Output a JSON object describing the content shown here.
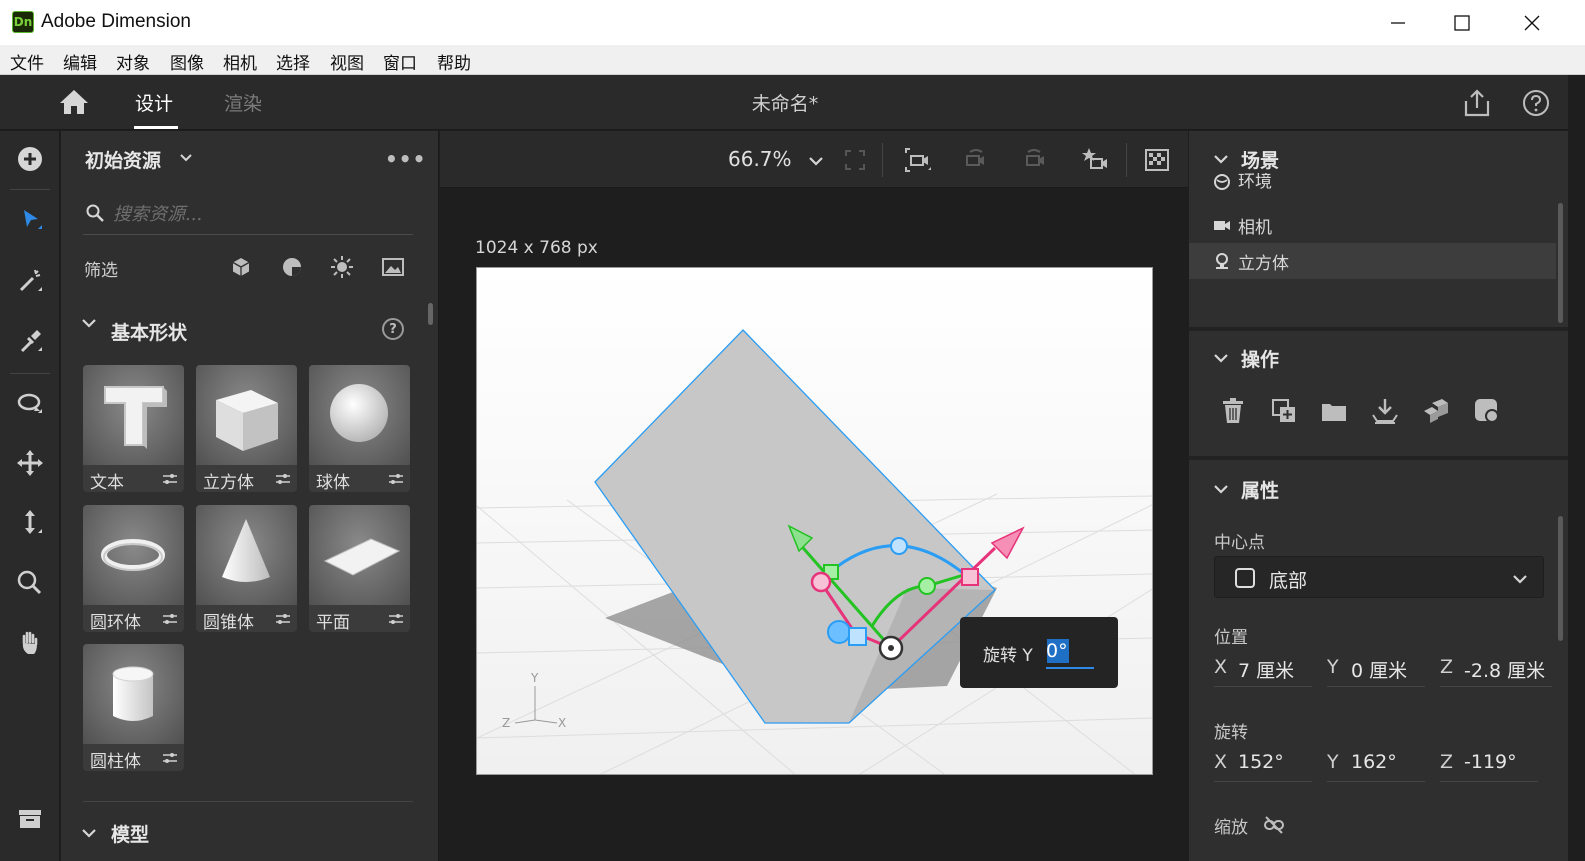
{
  "window": {
    "app_title": "Adobe Dimension",
    "logo_text": "Dn",
    "minimize": "—",
    "maximize": "☐",
    "close": "✕"
  },
  "menu": [
    "文件",
    "编辑",
    "对象",
    "图像",
    "相机",
    "选择",
    "视图",
    "窗口",
    "帮助"
  ],
  "appbar": {
    "tabs": [
      "设计",
      "渲染"
    ],
    "active_tab": "设计",
    "document_title": "未命名*"
  },
  "tools": [
    "add-icon",
    "select-icon",
    "magic-wand-icon",
    "eyedropper-icon",
    "orbit-icon",
    "pan-icon",
    "dolly-icon",
    "zoom-icon",
    "hand-icon",
    "library-icon"
  ],
  "assets": {
    "title": "初始资源",
    "more": "•••",
    "search_placeholder": "搜索资源...",
    "filter_label": "筛选",
    "section_title": "基本形状",
    "help": "?",
    "shapes": [
      {
        "label": "文本",
        "icon": "text-3d"
      },
      {
        "label": "立方体",
        "icon": "cube"
      },
      {
        "label": "球体",
        "icon": "sphere"
      },
      {
        "label": "圆环体",
        "icon": "torus"
      },
      {
        "label": "圆锥体",
        "icon": "cone"
      },
      {
        "label": "平面",
        "icon": "plane"
      },
      {
        "label": "圆柱体",
        "icon": "cylinder"
      }
    ],
    "models_title": "模型"
  },
  "canvas": {
    "zoom": "66.7%",
    "size_label": "1024 x 768 px",
    "axis_labels": {
      "y": "Y",
      "z": "Z",
      "x": "X"
    },
    "rotate_label": "旋转 Y",
    "rotate_value": "0°"
  },
  "right_panel": {
    "scene_title": "场景",
    "scene_items": [
      {
        "label": "环境",
        "icon": "environment-icon"
      },
      {
        "label": "相机",
        "icon": "camera-icon"
      },
      {
        "label": "立方体",
        "icon": "object-icon",
        "selected": true
      }
    ],
    "actions_title": "操作",
    "actions": [
      "delete-icon",
      "duplicate-icon",
      "group-icon",
      "place-on-ground-icon",
      "align-icon",
      "convert-icon"
    ],
    "properties_title": "属性",
    "pivot_label": "中心点",
    "pivot_value": "底部",
    "position_label": "位置",
    "position": {
      "x": "7 厘米",
      "y": "0 厘米",
      "z": "-2.8 厘米"
    },
    "rotation_label": "旋转",
    "rotation": {
      "x": "152°",
      "y": "162°",
      "z": "-119°"
    },
    "scale_label": "缩放"
  },
  "colors": {
    "accent_blue": "#2e8ae6",
    "gizmo_green": "#22c322",
    "gizmo_pink": "#e6337a",
    "gizmo_blue": "#2a9df4",
    "logo_green": "#7ad03a"
  }
}
